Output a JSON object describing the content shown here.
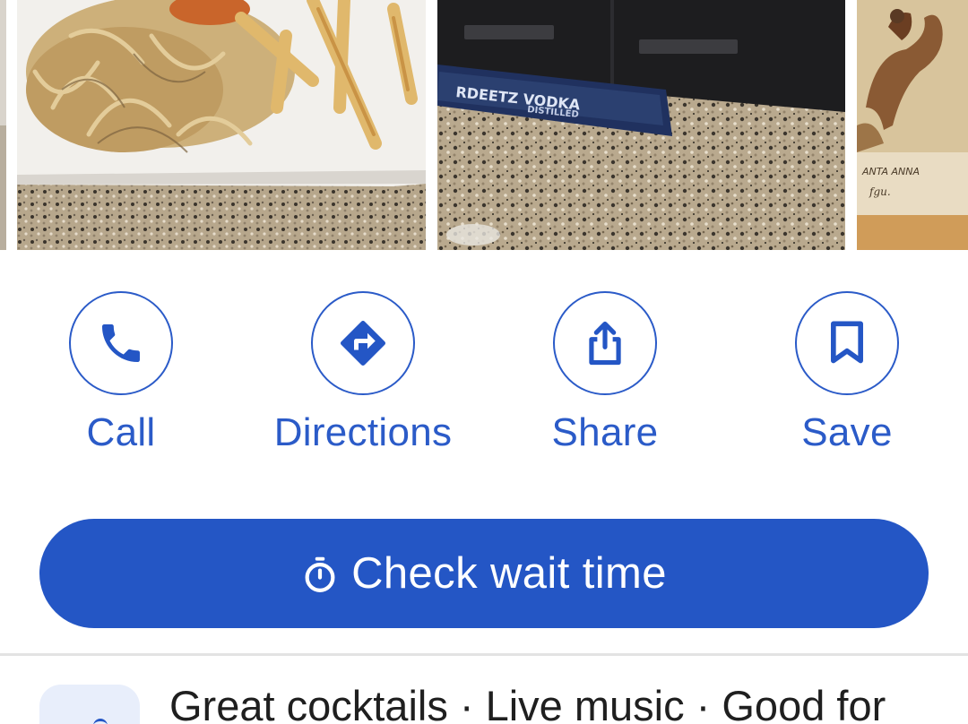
{
  "photos": [
    {
      "name": "partial-photo-left"
    },
    {
      "name": "fries-photo"
    },
    {
      "name": "bar-mat-photo",
      "mat_text": "RDEETZ VODKA",
      "mat_subtext": "DISTILLED"
    },
    {
      "name": "painting-photo",
      "caption": "ANTA ANNA"
    }
  ],
  "actions": {
    "call": {
      "label": "Call",
      "icon": "phone-icon"
    },
    "directions": {
      "label": "Directions",
      "icon": "directions-icon"
    },
    "share": {
      "label": "Share",
      "icon": "share-icon"
    },
    "save": {
      "label": "Save",
      "icon": "bookmark-icon"
    }
  },
  "wait_button": {
    "label": "Check wait time",
    "icon": "timer-icon"
  },
  "highlights": {
    "text": "Great cocktails · Live music · Good for"
  },
  "colors": {
    "accent": "#2456c5",
    "accent_text": "#2b5bc8",
    "divider": "#e3e3e3",
    "text": "#1f1f1f"
  }
}
